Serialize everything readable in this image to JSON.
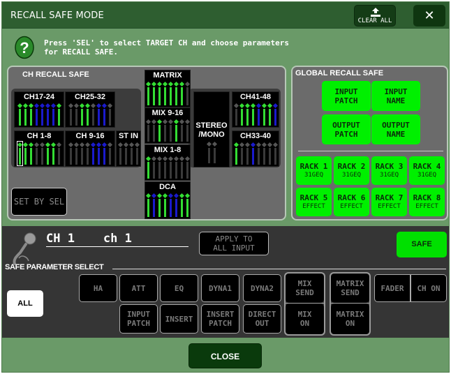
{
  "window": {
    "title": "RECALL SAFE MODE",
    "clear_all_label": "CLEAR ALL",
    "close_x_label": "✕"
  },
  "help": {
    "icon": "question-icon",
    "line1": "Press 'SEL' to select TARGET CH and choose parameters",
    "line2": "for RECALL SAFE."
  },
  "ch_recall_safe": {
    "title": "CH RECALL SAFE",
    "set_by_sel_label": "SET BY SEL",
    "blocks": [
      {
        "id": "ch17-24",
        "label": "CH17-24",
        "states": [
          "g",
          "g",
          "g",
          "b",
          "b",
          "b",
          "b",
          "g"
        ]
      },
      {
        "id": "ch25-32",
        "label": "CH25-32",
        "states": [
          "o",
          "o",
          "g",
          "g",
          "o",
          "b",
          "b",
          "o"
        ]
      },
      {
        "id": "ch1-8",
        "label": "CH 1-8",
        "states": [
          "g",
          "g",
          "g",
          "o",
          "o",
          "g",
          "g",
          "o"
        ],
        "selected_index": 0
      },
      {
        "id": "ch9-16",
        "label": "CH 9-16",
        "states": [
          "o",
          "o",
          "o",
          "o",
          "b",
          "b",
          "b",
          "o"
        ]
      },
      {
        "id": "stin",
        "label": "ST IN",
        "states": [
          "o",
          "o",
          "o",
          "o"
        ]
      },
      {
        "id": "matrix",
        "label": "MATRIX",
        "states": [
          "g",
          "g",
          "g",
          "g",
          "g",
          "g",
          "g",
          "o"
        ]
      },
      {
        "id": "mix9-16",
        "label": "MIX 9-16",
        "states": [
          "o",
          "o",
          "g",
          "o",
          "o",
          "g",
          "o",
          "o"
        ]
      },
      {
        "id": "mix1-8",
        "label": "MIX 1-8",
        "states": [
          "g",
          "o",
          "o",
          "o",
          "o",
          "o",
          "o",
          "o"
        ]
      },
      {
        "id": "dca",
        "label": "DCA",
        "states": [
          "g",
          "b",
          "g",
          "g",
          "b",
          "b",
          "g",
          "g"
        ]
      },
      {
        "id": "stereo-mono",
        "label": "STEREO\n/MONO",
        "states": [
          "o",
          "o"
        ]
      },
      {
        "id": "ch41-48",
        "label": "CH41-48",
        "states": [
          "o",
          "g",
          "g",
          "g",
          "b",
          "g",
          "g",
          "b"
        ]
      },
      {
        "id": "ch33-40",
        "label": "CH33-40",
        "states": [
          "g",
          "o",
          "o",
          "b",
          "o",
          "o",
          "o",
          "o"
        ]
      }
    ]
  },
  "global_recall_safe": {
    "title": "GLOBAL RECALL SAFE",
    "top_buttons": [
      {
        "line1": "INPUT",
        "line2": "PATCH"
      },
      {
        "line1": "INPUT",
        "line2": "NAME"
      },
      {
        "line1": "OUTPUT",
        "line2": "PATCH"
      },
      {
        "line1": "OUTPUT",
        "line2": "NAME"
      }
    ],
    "racks": [
      {
        "label": "RACK 1",
        "sub": "31GEQ"
      },
      {
        "label": "RACK 2",
        "sub": "31GEQ"
      },
      {
        "label": "RACK 3",
        "sub": "31GEQ"
      },
      {
        "label": "RACK 4",
        "sub": "31GEQ"
      },
      {
        "label": "RACK 5",
        "sub": "EFFECT"
      },
      {
        "label": "RACK 6",
        "sub": "EFFECT"
      },
      {
        "label": "RACK 7",
        "sub": "EFFECT"
      },
      {
        "label": "RACK 8",
        "sub": "EFFECT"
      }
    ]
  },
  "channel": {
    "icon": "microphone-icon",
    "name": "CH 1    ch 1",
    "apply_line1": "APPLY TO",
    "apply_line2": "ALL INPUT",
    "safe_label": "SAFE"
  },
  "safe_parameter_select": {
    "title": "SAFE PARAMETER SELECT",
    "all_label": "ALL",
    "buttons": {
      "ha": "HA",
      "att": "ATT",
      "eq": "EQ",
      "dyna1": "DYNA1",
      "dyna2": "DYNA2",
      "input_patch_1": "INPUT",
      "input_patch_2": "PATCH",
      "insert": "INSERT",
      "insert_patch_1": "INSERT",
      "insert_patch_2": "PATCH",
      "direct_out_1": "DIRECT",
      "direct_out_2": "OUT",
      "mix_send_1": "MIX",
      "mix_send_2": "SEND",
      "mix_on_1": "MIX",
      "mix_on_2": "ON",
      "matrix_send_1": "MATRIX",
      "matrix_send_2": "SEND",
      "matrix_on_1": "MATRIX",
      "matrix_on_2": "ON",
      "fader": "FADER",
      "ch_on": "CH ON"
    }
  },
  "footer": {
    "close_label": "CLOSE"
  },
  "colors": {
    "window_bg": "#6a9a68",
    "titlebar": "#2e5e30",
    "safe_green": "#00f000",
    "fader_green": "#33dd33",
    "fader_blue": "#1a1acc",
    "fader_off": "#3a3a3a"
  }
}
